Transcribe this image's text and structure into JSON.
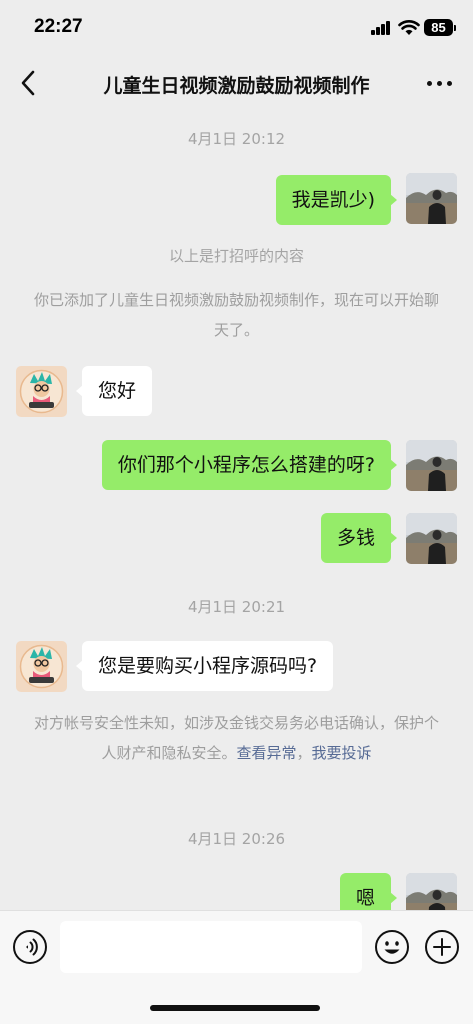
{
  "status_bar": {
    "time": "22:27",
    "battery": "85",
    "icons": [
      "signal-icon",
      "wifi-icon",
      "battery-icon"
    ]
  },
  "nav": {
    "title": "儿童生日视频激励鼓励视频制作",
    "back_icon": "chevron-left-icon",
    "more_icon": "more-dots-icon"
  },
  "messages": {
    "ts1": "4月1日 20:12",
    "msg1": "我是凯少)",
    "sys1": "以上是打招呼的内容",
    "sys2": "你已添加了儿童生日视频激励鼓励视频制作，现在可以开始聊天了。",
    "msg2": "您好",
    "msg3": "你们那个小程序怎么搭建的呀?",
    "msg4": "多钱",
    "ts2": "4月1日 20:21",
    "msg5": "您是要购买小程序源码吗?",
    "warn_text": "对方帐号安全性未知，如涉及金钱交易务必电话确认，保护个人财产和隐私安全。",
    "warn_link1": "查看异常",
    "warn_sep": "，",
    "warn_link2": "我要投诉",
    "ts3": "4月1日 20:26",
    "msg6": "嗯"
  },
  "input_bar": {
    "voice_icon": "voice-icon",
    "emoji_icon": "emoji-icon",
    "plus_icon": "plus-icon",
    "placeholder": ""
  },
  "colors": {
    "background": "#ededed",
    "my_bubble": "#95ec69",
    "their_bubble": "#ffffff",
    "link": "#576b95",
    "system_text": "#9e9e9e"
  }
}
